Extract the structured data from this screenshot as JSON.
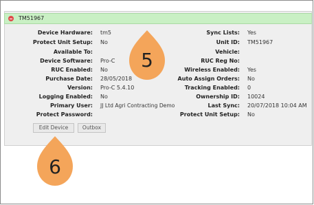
{
  "header": {
    "title": "TM51967"
  },
  "left_fields": [
    {
      "label": "Device Hardware:",
      "value": "tm5"
    },
    {
      "label": "Protect Unit Setup:",
      "value": "No"
    },
    {
      "label": "Available To:",
      "value": ""
    },
    {
      "label": "Device Software:",
      "value": "Pro-C"
    },
    {
      "label": "RUC Enabled:",
      "value": "No"
    },
    {
      "label": "Purchase Date:",
      "value": "28/05/2018"
    },
    {
      "label": "Version:",
      "value": "Pro-C 5.4.10"
    },
    {
      "label": "Logging Enabled:",
      "value": "No"
    },
    {
      "label": "Primary User:",
      "value": "JJ Ltd Agri Contracting Demo"
    },
    {
      "label": "Protect Password:",
      "value": ""
    }
  ],
  "right_fields": [
    {
      "label": "Sync Lists:",
      "value": "Yes"
    },
    {
      "label": "Unit ID:",
      "value": "TM51967"
    },
    {
      "label": "Vehicle:",
      "value": ""
    },
    {
      "label": "RUC Reg No:",
      "value": ""
    },
    {
      "label": "Wireless Enabled:",
      "value": "Yes"
    },
    {
      "label": "Auto Assign Orders:",
      "value": "No"
    },
    {
      "label": "Tracking Enabled:",
      "value": "0"
    },
    {
      "label": "Ownership ID:",
      "value": "10024"
    },
    {
      "label": "Last Sync:",
      "value": "20/07/2018 10:04 AM"
    },
    {
      "label": "Protect Unit Setup:",
      "value": "No"
    }
  ],
  "buttons": {
    "edit_device": "Edit Device",
    "outbox": "Outbox"
  },
  "callouts": {
    "five": "5",
    "six": "6",
    "color": "#f4a55a"
  },
  "colors": {
    "header_bg": "#c9f0c4",
    "close_icon": "#e04b4b",
    "panel_bg": "#efefef"
  }
}
